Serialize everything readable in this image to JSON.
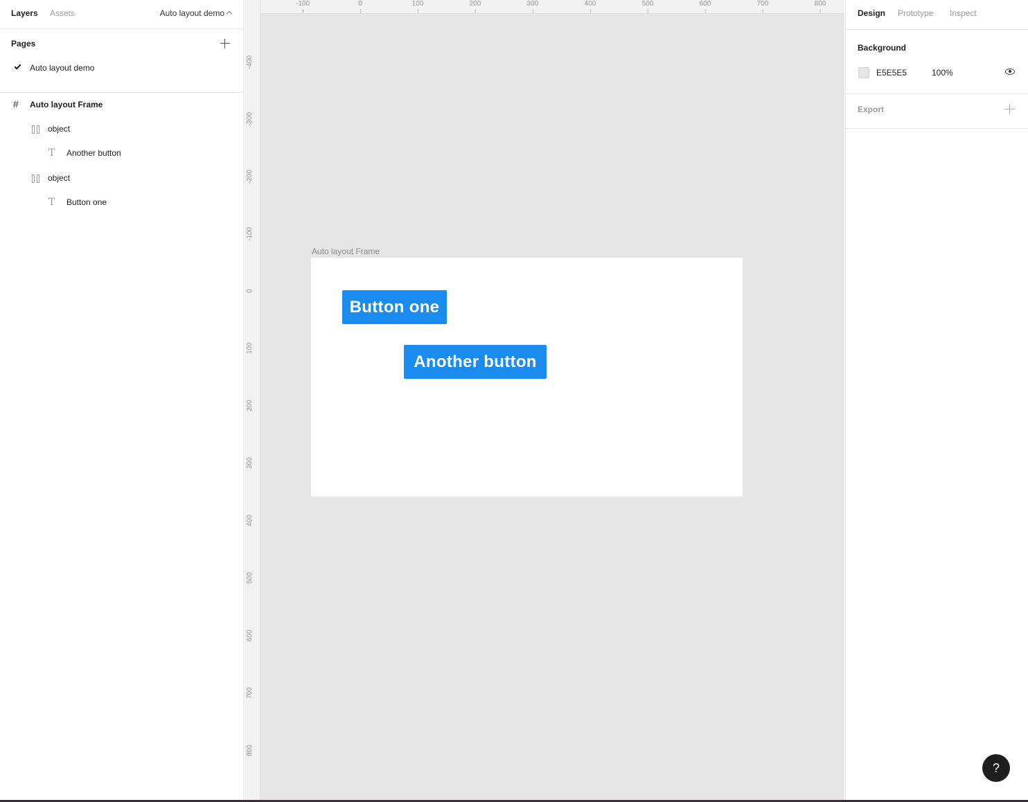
{
  "left_panel": {
    "tabs": {
      "layers": "Layers",
      "assets": "Assets"
    },
    "page_switcher": "Auto layout demo",
    "pages_title": "Pages",
    "pages": [
      {
        "label": "Auto layout demo",
        "selected": true
      }
    ],
    "layers": [
      {
        "label": "Auto layout Frame",
        "icon": "frame-hash-icon"
      },
      {
        "label": "object",
        "icon": "auto-layout-icon"
      },
      {
        "label": "Another button",
        "icon": "text-icon"
      },
      {
        "label": "object",
        "icon": "auto-layout-icon"
      },
      {
        "label": "Button one",
        "icon": "text-icon"
      }
    ]
  },
  "canvas": {
    "ruler_x": [
      "-100",
      "0",
      "100",
      "200",
      "300",
      "400",
      "500",
      "600",
      "700",
      "800"
    ],
    "ruler_y": [
      "-400",
      "-300",
      "-200",
      "-100",
      "0",
      "100",
      "200",
      "300",
      "400",
      "500",
      "600",
      "700",
      "800"
    ],
    "frame_label": "Auto layout Frame",
    "buttons": {
      "one": "Button one",
      "two": "Another button"
    },
    "button_color": "#1a8cf0",
    "background_color": "#e5e5e5"
  },
  "right_panel": {
    "tabs": {
      "design": "Design",
      "prototype": "Prototype",
      "inspect": "Inspect"
    },
    "background_title": "Background",
    "background_hex": "E5E5E5",
    "background_opacity": "100%",
    "export_title": "Export"
  },
  "help_label": "?"
}
